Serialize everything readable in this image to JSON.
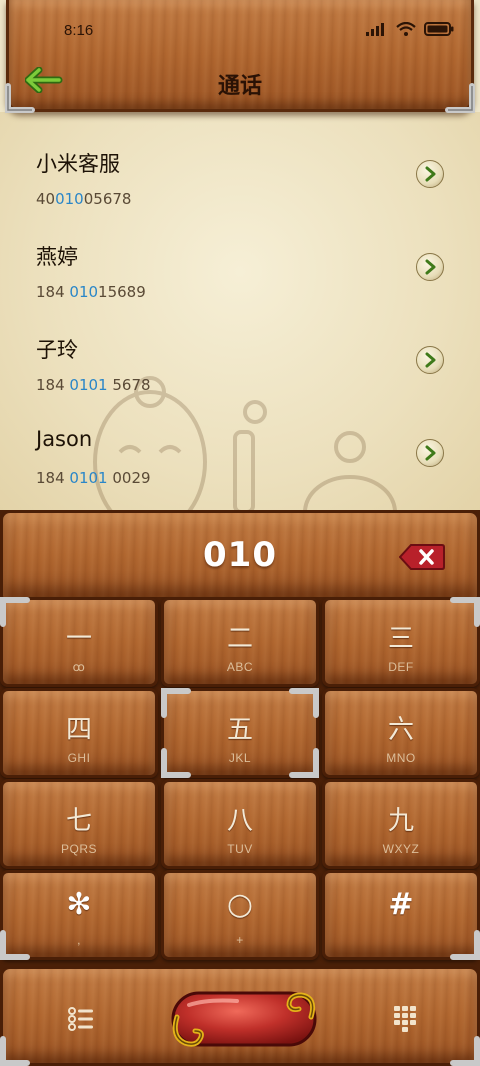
{
  "status_bar": {
    "time": "8:16"
  },
  "header": {
    "title": "通话"
  },
  "contacts": [
    {
      "name": "小米客服",
      "number_pre": "40",
      "number_match": "010",
      "number_post": "05678"
    },
    {
      "name": "燕婷",
      "number_pre": "184 ",
      "number_match": "010",
      "number_post": "15689"
    },
    {
      "name": "子玲",
      "number_pre": "184 ",
      "number_match": "0101",
      "number_post": " 5678"
    },
    {
      "name": "Jason",
      "number_pre": "184 ",
      "number_match": "0101",
      "number_post": " 0029"
    }
  ],
  "dialer": {
    "display_number": "010",
    "keys": [
      {
        "glyph": "一",
        "letters": "ꝏ"
      },
      {
        "glyph": "二",
        "letters": "ABC"
      },
      {
        "glyph": "三",
        "letters": "DEF"
      },
      {
        "glyph": "四",
        "letters": "GHI"
      },
      {
        "glyph": "五",
        "letters": "JKL"
      },
      {
        "glyph": "六",
        "letters": "MNO"
      },
      {
        "glyph": "七",
        "letters": "PQRS"
      },
      {
        "glyph": "八",
        "letters": "TUV"
      },
      {
        "glyph": "九",
        "letters": "WXYZ"
      },
      {
        "glyph": "✻",
        "letters": ","
      },
      {
        "glyph": "○",
        "letters": "+"
      },
      {
        "glyph": "#",
        "letters": ""
      }
    ]
  },
  "colors": {
    "match_highlight": "#2a86c8",
    "wood": "#b0662f",
    "parchment": "#efe6c9",
    "call_button": "#c0302a"
  },
  "icons": {
    "back": "back-arrow-icon",
    "detail": "chevron-right-icon",
    "delete": "backspace-icon",
    "menu": "list-icon",
    "keypad": "keypad-icon",
    "call": "call-icon"
  }
}
